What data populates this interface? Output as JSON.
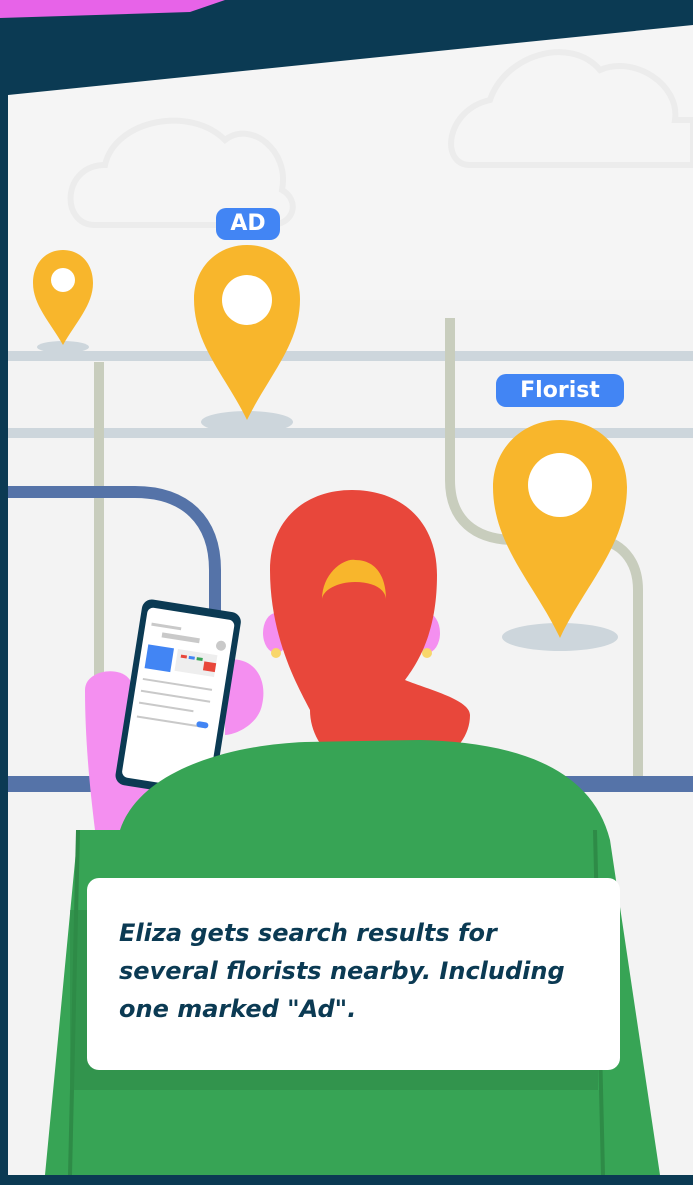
{
  "labels": {
    "ad_badge": "AD",
    "florist_badge": "Florist"
  },
  "caption": {
    "text": "Eliza gets search results for several florists nearby. Including one marked \"Ad\"."
  },
  "colors": {
    "frame": "#0b3a53",
    "background": "#f5f5f5",
    "pin": "#f8b62c",
    "badge": "#4285f4",
    "hair": "#e8473b",
    "shirt": "#37a455",
    "skin": "#f48ff0",
    "road_blue": "#5573a8",
    "road_grey": "#cdd6dc",
    "road_olive": "#c8cdbd"
  }
}
